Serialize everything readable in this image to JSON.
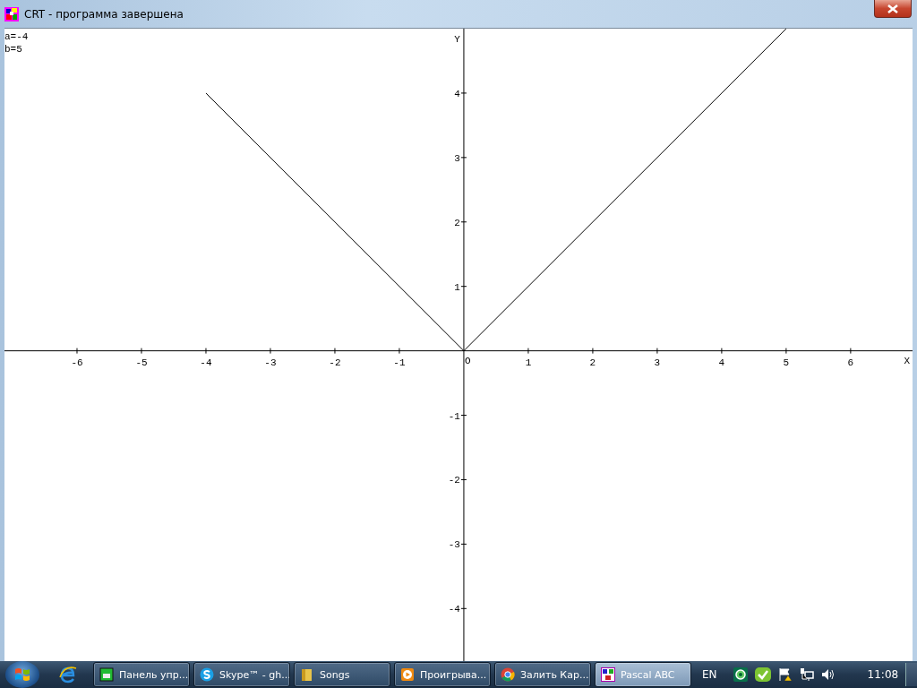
{
  "window": {
    "title": "CRT - программа завершена"
  },
  "output_lines": [
    "a=-4",
    "b=5"
  ],
  "graph": {
    "origin_label": "O",
    "chart_data": {
      "type": "line",
      "xlabel": "X",
      "ylabel": "Y",
      "x": [
        -4,
        0,
        5
      ],
      "xlim": [
        -7.125,
        6.96
      ],
      "ylim": [
        -4.83,
        5.0
      ],
      "xticks": [
        -6,
        -5,
        -4,
        -3,
        -2,
        -1,
        1,
        2,
        3,
        4,
        5,
        6
      ],
      "yticks": [
        -4,
        -3,
        -2,
        -1,
        1,
        2,
        3,
        4
      ],
      "series": [
        {
          "color": "#000000",
          "values": [
            4,
            0,
            5
          ]
        }
      ]
    }
  },
  "taskbar": {
    "items": [
      {
        "kind": "control",
        "label": "Панель упр...",
        "selected": false
      },
      {
        "kind": "skype",
        "label": "Skype™ - gh...",
        "selected": false
      },
      {
        "kind": "folder",
        "label": "Songs",
        "selected": false
      },
      {
        "kind": "player",
        "label": "Проигрыва...",
        "selected": false
      },
      {
        "kind": "browser",
        "label": "Залить Кар...",
        "selected": false
      },
      {
        "kind": "pascal",
        "label": "Pascal ABC",
        "selected": true
      }
    ],
    "language": "EN",
    "clock": "11:08"
  }
}
